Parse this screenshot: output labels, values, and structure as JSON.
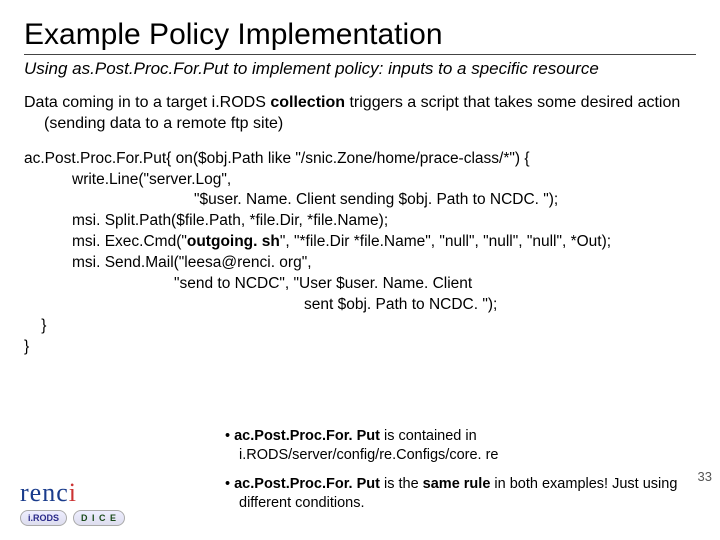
{
  "title": "Example Policy Implementation",
  "subtitle": "Using as.Post.Proc.For.Put to implement policy: inputs to a specific resource",
  "body1_pre": "Data coming in to a target i.RODS ",
  "body1_bold": "collection",
  "body1_post": " triggers a script that takes some desired action (sending data to a remote ftp site)",
  "code": {
    "l0": "ac.Post.Proc.For.Put{ on($obj.Path like \"/snic.Zone/home/prace-class/*\") {",
    "l1a": "write.Line(\"server.Log\",",
    "l2a": "\"$user. Name. Client sending $obj. Path to NCDC. \");",
    "l1b": "msi. Split.Path($file.Path, *file.Dir, *file.Name);",
    "l1c_pre": "msi. Exec.Cmd(\"",
    "l1c_bold": "outgoing. sh",
    "l1c_post": "\", \"*file.Dir *file.Name\", \"null\", \"null\", \"null\", *Out);",
    "l1d": "msi. Send.Mail(\"leesa@renci. org\",",
    "l3a": "\"send to NCDC\", \"User $user. Name. Client",
    "l4a": "sent $obj. Path to NCDC. \");",
    "close1": "    }",
    "close2": "}"
  },
  "bullets": {
    "b1_pre": "• ",
    "b1_bold": "ac.Post.Proc.For. Put",
    "b1_post": " is contained in i.RODS/server/config/re.Configs/core. re",
    "b2_pre": "• ",
    "b2_bold": "ac.Post.Proc.For. Put",
    "b2_mid": " is the ",
    "b2_bold2": "same rule",
    "b2_post": " in both examples! Just using different conditions."
  },
  "pagenum": "33",
  "logos": {
    "renci": "renci",
    "irods": "i.RODS",
    "dice": "D I C E"
  }
}
